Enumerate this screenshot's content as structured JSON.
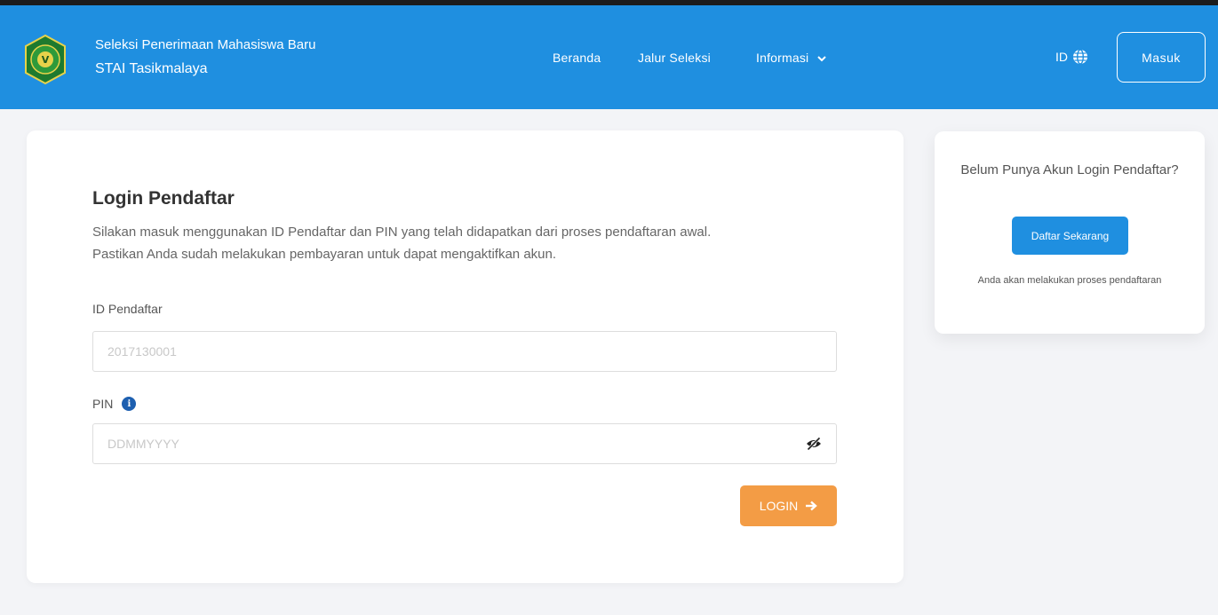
{
  "header": {
    "brand_line1": "Seleksi Penerimaan Mahasiswa Baru",
    "brand_line2": "STAI Tasikmalaya",
    "nav": {
      "beranda": "Beranda",
      "jalur": "Jalur Seleksi",
      "informasi": "Informasi"
    },
    "language": "ID",
    "login_button": "Masuk",
    "bg_color": "#1f8fe0"
  },
  "login_form": {
    "title": "Login Pendaftar",
    "description_line1": "Silakan masuk menggunakan ID Pendaftar dan PIN yang telah didapatkan dari proses pendaftaran awal.",
    "description_line2": "Pastikan Anda sudah melakukan pembayaran untuk dapat mengaktifkan akun.",
    "id_label": "ID Pendaftar",
    "id_placeholder": "2017130001",
    "id_value": "",
    "pin_label": "PIN",
    "pin_placeholder": "DDMMYYYY",
    "pin_value": "",
    "submit_label": "LOGIN",
    "submit_color": "#f39c45"
  },
  "sidebar_card": {
    "question": "Belum Punya Akun Login Pendaftar?",
    "register_button": "Daftar Sekarang",
    "note": "Anda akan melakukan proses pendaftaran"
  },
  "icons": {
    "logo": "stai-logo-icon",
    "chevron": "chevron-down-icon",
    "globe": "globe-icon",
    "info": "info-icon",
    "eye": "eye-slash-icon",
    "arrow": "arrow-right-icon"
  }
}
